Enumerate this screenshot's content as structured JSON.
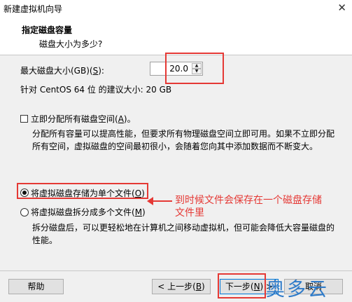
{
  "window": {
    "title": "新建虚拟机向导",
    "close_glyph": "✕"
  },
  "header": {
    "title": "指定磁盘容量",
    "subtitle": "磁盘大小为多少?"
  },
  "disk_size": {
    "label": "最大磁盘大小(GB)(",
    "label_key": "S",
    "label_end": "):",
    "value": "20.0",
    "recommend": "针对 CentOS 64 位 的建议大小: 20 GB"
  },
  "allocate": {
    "label": "立即分配所有磁盘空间(",
    "label_key": "A",
    "label_end": ")。",
    "checked": false,
    "desc_line1": "分配所有容量可以提高性能，但要求所有物理磁盘空间立即可用。如果不立即分配",
    "desc_line2": "所有空间，虚拟磁盘的空间最初很小，会随着您向其中添加数据而不断变大。"
  },
  "single_file": {
    "label": "将虚拟磁盘存储为单个文件(",
    "label_key": "O",
    "label_end": ")",
    "checked": true
  },
  "multi_file": {
    "label": "将虚拟磁盘拆分成多个文件(",
    "label_key": "M",
    "label_end": ")",
    "checked": false,
    "desc_line1": "拆分磁盘后，可以更轻松地在计算机之间移动虚拟机，但可能会降低大容量磁盘的",
    "desc_line2": "性能。"
  },
  "annotation": {
    "line1": "到时候文件会保存在一个磁盘存储",
    "line2": "文件里",
    "color": "#e53935"
  },
  "buttons": {
    "help": "帮助",
    "back": "< 上一步(",
    "back_key": "B",
    "back_end": ")",
    "next": "下一步(",
    "next_key": "N",
    "next_end": ") >",
    "cancel": "取消"
  },
  "watermark": "奥多云"
}
